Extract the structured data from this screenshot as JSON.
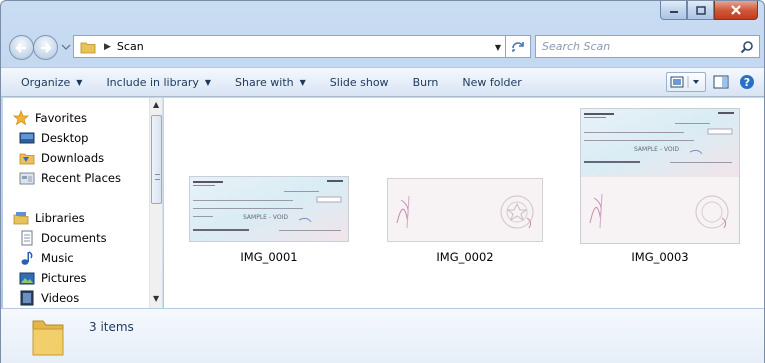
{
  "address": {
    "crumb": "Scan"
  },
  "search": {
    "placeholder": "Search Scan"
  },
  "toolbar": {
    "organize": "Organize",
    "include": "Include in library",
    "share": "Share with",
    "slideshow": "Slide show",
    "burn": "Burn",
    "newfolder": "New folder"
  },
  "nav": {
    "favorites": "Favorites",
    "desktop": "Desktop",
    "downloads": "Downloads",
    "recent": "Recent Places",
    "libraries": "Libraries",
    "documents": "Documents",
    "music": "Music",
    "pictures": "Pictures",
    "videos": "Videos"
  },
  "files": [
    {
      "name": "IMG_0001",
      "check_text": "SAMPLE - VOID"
    },
    {
      "name": "IMG_0002"
    },
    {
      "name": "IMG_0003",
      "check_text": "SAMPLE - VOID"
    }
  ],
  "details": {
    "count": "3 items"
  },
  "colors": {
    "accent": "#1e395b",
    "close": "#c3391c"
  }
}
